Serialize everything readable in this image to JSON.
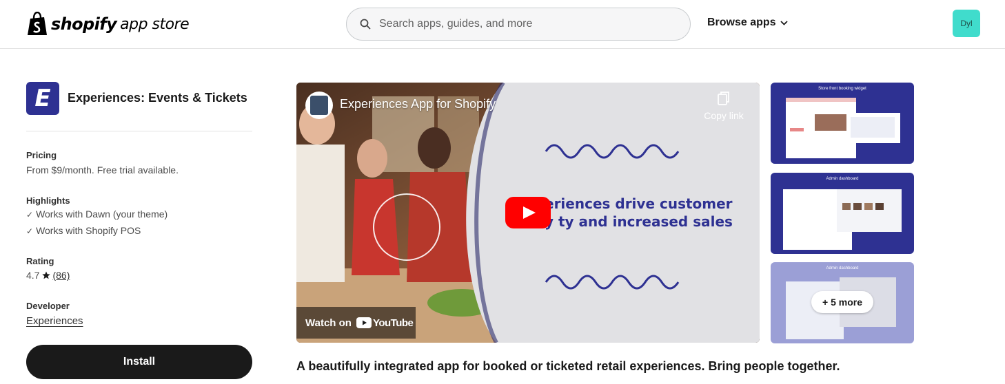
{
  "header": {
    "logo_word": "shopify",
    "logo_sub": "app store",
    "search_placeholder": "Search apps, guides, and more",
    "browse_label": "Browse apps",
    "avatar_initials": "Dyl"
  },
  "app": {
    "icon_letter": "E",
    "name": "Experiences: Events & Tickets",
    "pricing": {
      "label": "Pricing",
      "value": "From $9/month. Free trial available."
    },
    "highlights": {
      "label": "Highlights",
      "items": [
        "Works with Dawn (your theme)",
        "Works with Shopify POS"
      ]
    },
    "rating": {
      "label": "Rating",
      "value": "4.7",
      "count": "(86)"
    },
    "developer": {
      "label": "Developer",
      "name": "Experiences"
    },
    "install_label": "Install",
    "tagline": "A beautifully integrated app for booked or ticketed retail experiences. Bring people together."
  },
  "video": {
    "title": "Experiences App for Shopify",
    "copy_link": "Copy link",
    "watch_on": "Watch on",
    "youtube": "YouTube",
    "overlay_line1": "eriences drive customer",
    "overlay_line2": "y   ty and increased sales"
  },
  "thumbnails": [
    {
      "title": "Store front booking widget",
      "color": "#2e3192"
    },
    {
      "title": "Admin dashboard",
      "color": "#2e3192"
    },
    {
      "title": "Admin dashboard",
      "color": "#9b9fd6"
    }
  ],
  "more_label": "+ 5 more",
  "colors": {
    "brand": "#2e3192",
    "avatar": "#40dccc",
    "install": "#1a1a1a",
    "youtube_red": "#ff0000"
  }
}
